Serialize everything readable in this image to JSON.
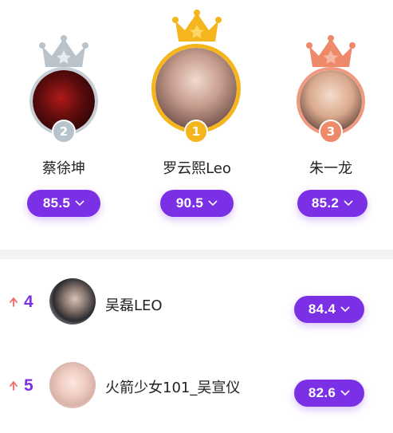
{
  "podium": [
    {
      "name": "蔡徐坤",
      "rank": "2",
      "score": "85.5",
      "crown_color": "#b9c3cc",
      "ring_color": "#c6ced6",
      "avatar_color": "#4a0c0c"
    },
    {
      "name": "罗云熙Leo",
      "rank": "1",
      "score": "90.5",
      "crown_color": "#f5b51c",
      "ring_color": "#f5b51c",
      "avatar_color": "#c8a596"
    },
    {
      "name": "朱一龙",
      "rank": "3",
      "score": "85.2",
      "crown_color": "#ee8a6a",
      "ring_color": "#ef9a80",
      "avatar_color": "#e2b495"
    }
  ],
  "list": [
    {
      "rank": "4",
      "name": "吴磊LEO",
      "score": "84.4",
      "trend": "up",
      "avatar_color": "#3a3a40"
    },
    {
      "rank": "5",
      "name": "火箭少女101_吴宣仪",
      "score": "82.6",
      "trend": "up",
      "avatar_color": "#f0d6cf"
    }
  ],
  "colors": {
    "accent": "#7b30e6",
    "trend_up": "#f06a6a"
  },
  "icons": {
    "score_dropdown": "chevron-down-icon",
    "trend": "arrow-up-icon"
  }
}
